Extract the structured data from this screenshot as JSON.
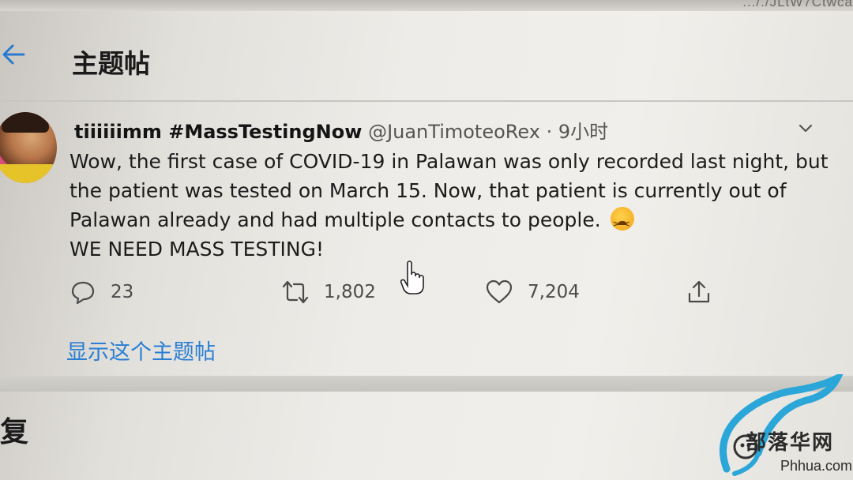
{
  "browser": {
    "url_fragment": "..././JLtW7Ctwca"
  },
  "header": {
    "back_icon": "arrow-left-icon",
    "title": "主题帖"
  },
  "tweet": {
    "display_name": "tiiiiiimm #MassTestingNow",
    "handle": "@JuanTimoteoRex",
    "separator": "·",
    "time": "9小时",
    "body_lines": [
      "Wow, the first case of COVID-19 in Palawan was only recorded last night, but",
      "the patient was tested on March 15. Now, that patient is currently out of",
      "Palawan already and had multiple contacts to people.",
      "WE NEED MASS TESTING!"
    ],
    "emoji": "tired-face-emoji",
    "actions": {
      "reply_count": "23",
      "retweet_count": "1,802",
      "like_count": "7,204"
    }
  },
  "show_thread": "显示这个主题帖",
  "reply_heading": "复",
  "watermark": {
    "text": "部落华网",
    "url": "Phhua.com"
  },
  "colors": {
    "link_blue": "#2a7ed4",
    "text": "#1c1c1c"
  }
}
